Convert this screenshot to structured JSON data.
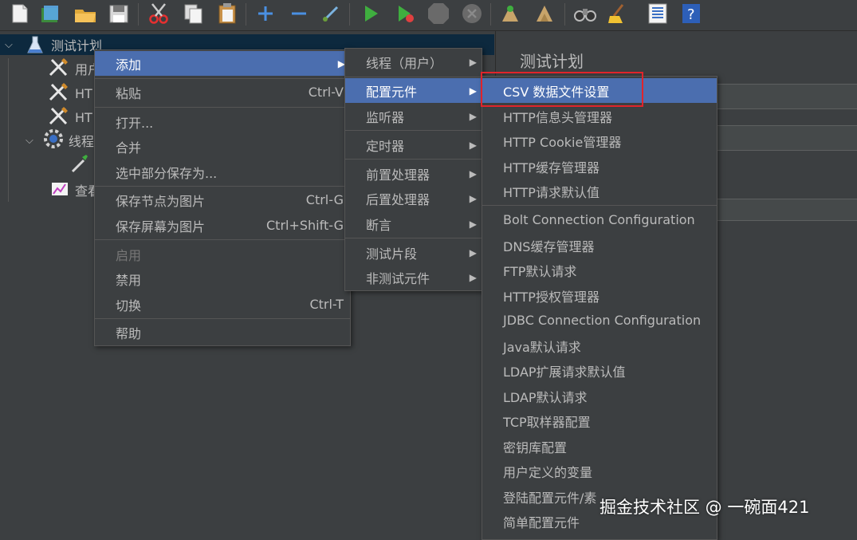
{
  "toolbar": {
    "icons": [
      "new-file-icon",
      "templates-icon",
      "open-icon",
      "save-icon",
      "cut-icon",
      "copy-icon",
      "paste-icon",
      "expand-icon",
      "collapse-icon",
      "toggle-icon",
      "start-icon",
      "start-no-pause-icon",
      "stop-icon",
      "shutdown-icon",
      "clear-icon",
      "clear-all-icon",
      "search-icon",
      "reset-search-icon",
      "function-helper-icon",
      "help-icon"
    ]
  },
  "tree": {
    "root": "测试计划",
    "items": [
      {
        "label": "用户",
        "icon": "wrench-icon"
      },
      {
        "label": "HT",
        "icon": "wrench-icon"
      },
      {
        "label": "HT",
        "icon": "wrench-icon"
      },
      {
        "label": "线程",
        "icon": "gear-icon"
      },
      {
        "label": "",
        "icon": "pipette-icon"
      },
      {
        "label": "查看",
        "icon": "report-icon"
      }
    ]
  },
  "right_panel": {
    "title": "测试计划"
  },
  "context_menu": {
    "items": [
      {
        "label": "添加",
        "accel": "",
        "submenu": true
      },
      {
        "label": "粘贴",
        "accel": "Ctrl-V"
      },
      {
        "label": "打开...",
        "accel": ""
      },
      {
        "label": "合并",
        "accel": ""
      },
      {
        "label": "选中部分保存为...",
        "accel": ""
      },
      {
        "label": "保存节点为图片",
        "accel": "Ctrl-G"
      },
      {
        "label": "保存屏幕为图片",
        "accel": "Ctrl+Shift-G"
      },
      {
        "label": "启用",
        "accel": "",
        "disabled": true
      },
      {
        "label": "禁用",
        "accel": ""
      },
      {
        "label": "切换",
        "accel": "Ctrl-T"
      },
      {
        "label": "帮助",
        "accel": ""
      }
    ]
  },
  "add_submenu": {
    "items": [
      "线程（用户）",
      "配置元件",
      "监听器",
      "定时器",
      "前置处理器",
      "后置处理器",
      "断言",
      "测试片段",
      "非测试元件"
    ]
  },
  "config_submenu": {
    "items": [
      "CSV 数据文件设置",
      "HTTP信息头管理器",
      "HTTP Cookie管理器",
      "HTTP缓存管理器",
      "HTTP请求默认值",
      "Bolt Connection Configuration",
      "DNS缓存管理器",
      "FTP默认请求",
      "HTTP授权管理器",
      "JDBC Connection Configuration",
      "Java默认请求",
      "LDAP扩展请求默认值",
      "LDAP默认请求",
      "TCP取样器配置",
      "密钥库配置",
      "用户定义的变量",
      "登陆配置元件/素",
      "简单配置元件"
    ]
  },
  "watermark": "掘金技术社区 @ 一碗面421",
  "colors": {
    "highlight": "#4b6eaf",
    "annotation": "#e0242b",
    "background": "#3c3f41"
  }
}
